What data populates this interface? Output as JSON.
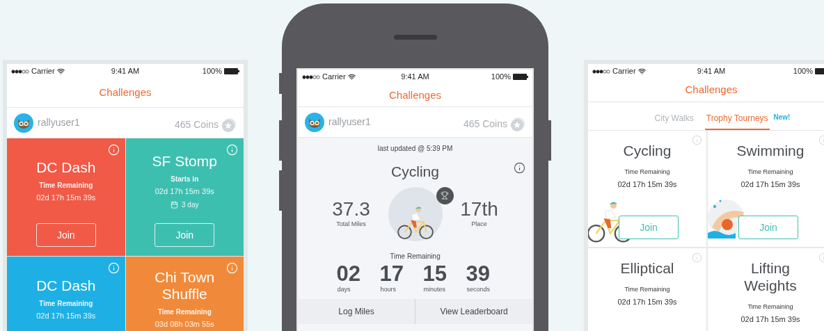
{
  "left_screen": {
    "status_bar": {
      "carrier": "Carrier",
      "time": "9:41 AM",
      "battery": "100%"
    },
    "title": "Challenges",
    "user": {
      "name": "rallyuser1",
      "coins": "465 Coins"
    },
    "challenges": [
      {
        "title": "DC Dash",
        "subtitle": "Time Remaining",
        "timer": "02d 17h 15m 39s",
        "button": "Join",
        "color": "#f05a47"
      },
      {
        "title": "SF Stomp",
        "subtitle": "Starts in",
        "timer": "02d 17h 15m 39s",
        "duration": "3 day",
        "button": "Join",
        "color": "#3dbfb0"
      },
      {
        "title": "DC Dash",
        "subtitle": "Time Remaining",
        "timer": "02d 17h 15m 39s",
        "color": "#1eb0e4"
      },
      {
        "title": "Chi Town Shuffle",
        "subtitle": "Time Remaining",
        "timer": "03d 08h 03m 55s",
        "color": "#f08a3a"
      }
    ]
  },
  "center_screen": {
    "status_bar": {
      "carrier": "Carrier",
      "time": "9:41 AM",
      "battery": "100%"
    },
    "title": "Challenges",
    "user": {
      "name": "rallyuser1",
      "coins": "465 Coins"
    },
    "last_updated": "last updated @ 5:39 PM",
    "challenge": "Cycling",
    "total_miles": {
      "value": "37.3",
      "label": "Total Miles"
    },
    "place": {
      "value": "17th",
      "label": "Place"
    },
    "time_remaining_label": "Time Remaining",
    "countdown": [
      {
        "value": "02",
        "unit": "days"
      },
      {
        "value": "17",
        "unit": "hours"
      },
      {
        "value": "15",
        "unit": "minutes"
      },
      {
        "value": "39",
        "unit": "seconds"
      }
    ],
    "buttons": [
      "Log Miles",
      "View Leaderboard"
    ]
  },
  "right_screen": {
    "status_bar": {
      "carrier": "Carrier",
      "time": "9:41 AM",
      "battery": "100%"
    },
    "title": "Challenges",
    "tabs": [
      {
        "label": "City Walks",
        "selected": false
      },
      {
        "label": "Trophy Tourneys",
        "selected": true,
        "badge": "New!"
      }
    ],
    "tourneys": [
      {
        "kind": "cycling",
        "title": "Cycling",
        "timer_label": "Time Remaining",
        "timer": "02d 17h 15m 39s",
        "button": "Join"
      },
      {
        "kind": "swimming",
        "title": "Swimming",
        "timer_label": "Time Remaining",
        "timer": "02d 17h 15m 39s",
        "button": "Join"
      },
      {
        "kind": "elliptical",
        "title": "Elliptical",
        "timer_label": "Time Remaining",
        "timer": "02d 17h 15m 39s"
      },
      {
        "kind": "weights",
        "title": "Lifting Weights",
        "timer_label": "Time Remaining",
        "timer": "02d 17h 15m 39s"
      }
    ]
  }
}
